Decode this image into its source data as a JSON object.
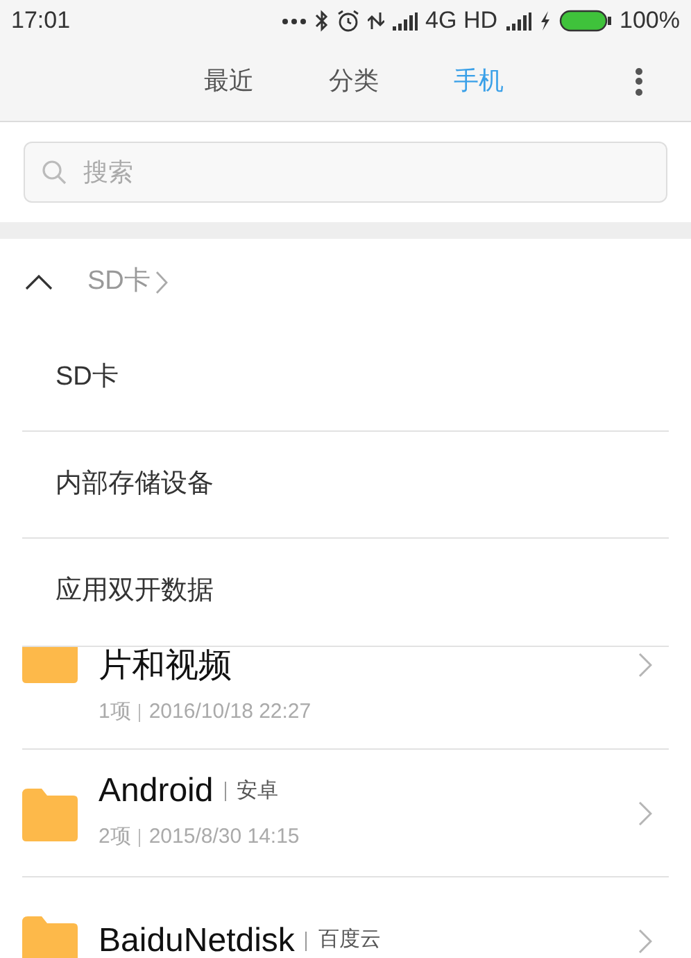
{
  "status_bar": {
    "time": "17:01",
    "network": "4G HD",
    "battery": "100%"
  },
  "tabs": [
    {
      "label": "最近",
      "selected": false
    },
    {
      "label": "分类",
      "selected": false
    },
    {
      "label": "手机",
      "selected": true
    }
  ],
  "search": {
    "placeholder": "搜索"
  },
  "storage_menu": {
    "expanded": true,
    "path": "SD卡",
    "items": [
      "SD卡",
      "内部存储设备",
      "应用双开数据"
    ]
  },
  "files": [
    {
      "name": "片和视频",
      "meta": "1项",
      "date": "2016/10/18 22:27",
      "partly_hidden": true
    },
    {
      "name": "Android",
      "alias": "安卓",
      "meta": "2项",
      "date": "2015/8/30 14:15",
      "partly_hidden": false
    },
    {
      "name": "BaiduNetdisk",
      "alias": "百度云",
      "partly_hidden": false
    }
  ]
}
